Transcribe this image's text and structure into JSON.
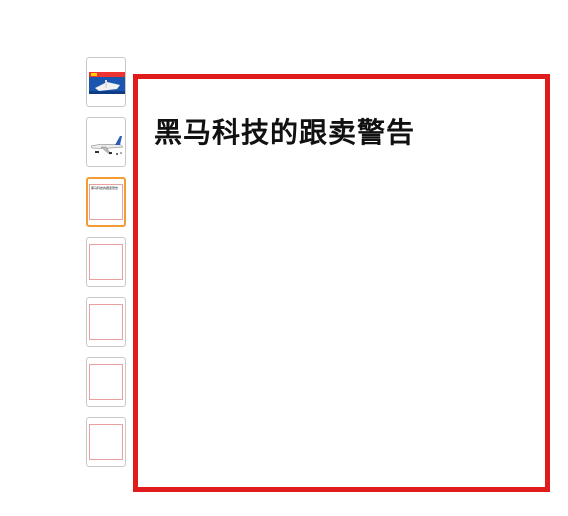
{
  "main": {
    "title": "黑马科技的跟卖警告",
    "border_color": "#e01b1b"
  },
  "thumbnails": [
    {
      "type": "image",
      "icon": "lego-box-icon",
      "selected": false
    },
    {
      "type": "image",
      "icon": "airplane-icon",
      "selected": false
    },
    {
      "type": "text-frame",
      "text": "黑马科技的跟卖警告",
      "selected": true
    },
    {
      "type": "frame",
      "selected": false
    },
    {
      "type": "frame",
      "selected": false
    },
    {
      "type": "frame",
      "selected": false
    },
    {
      "type": "frame",
      "selected": false
    }
  ],
  "colors": {
    "selected_outline": "#f39c33",
    "frame_border": "#e01b1b"
  }
}
